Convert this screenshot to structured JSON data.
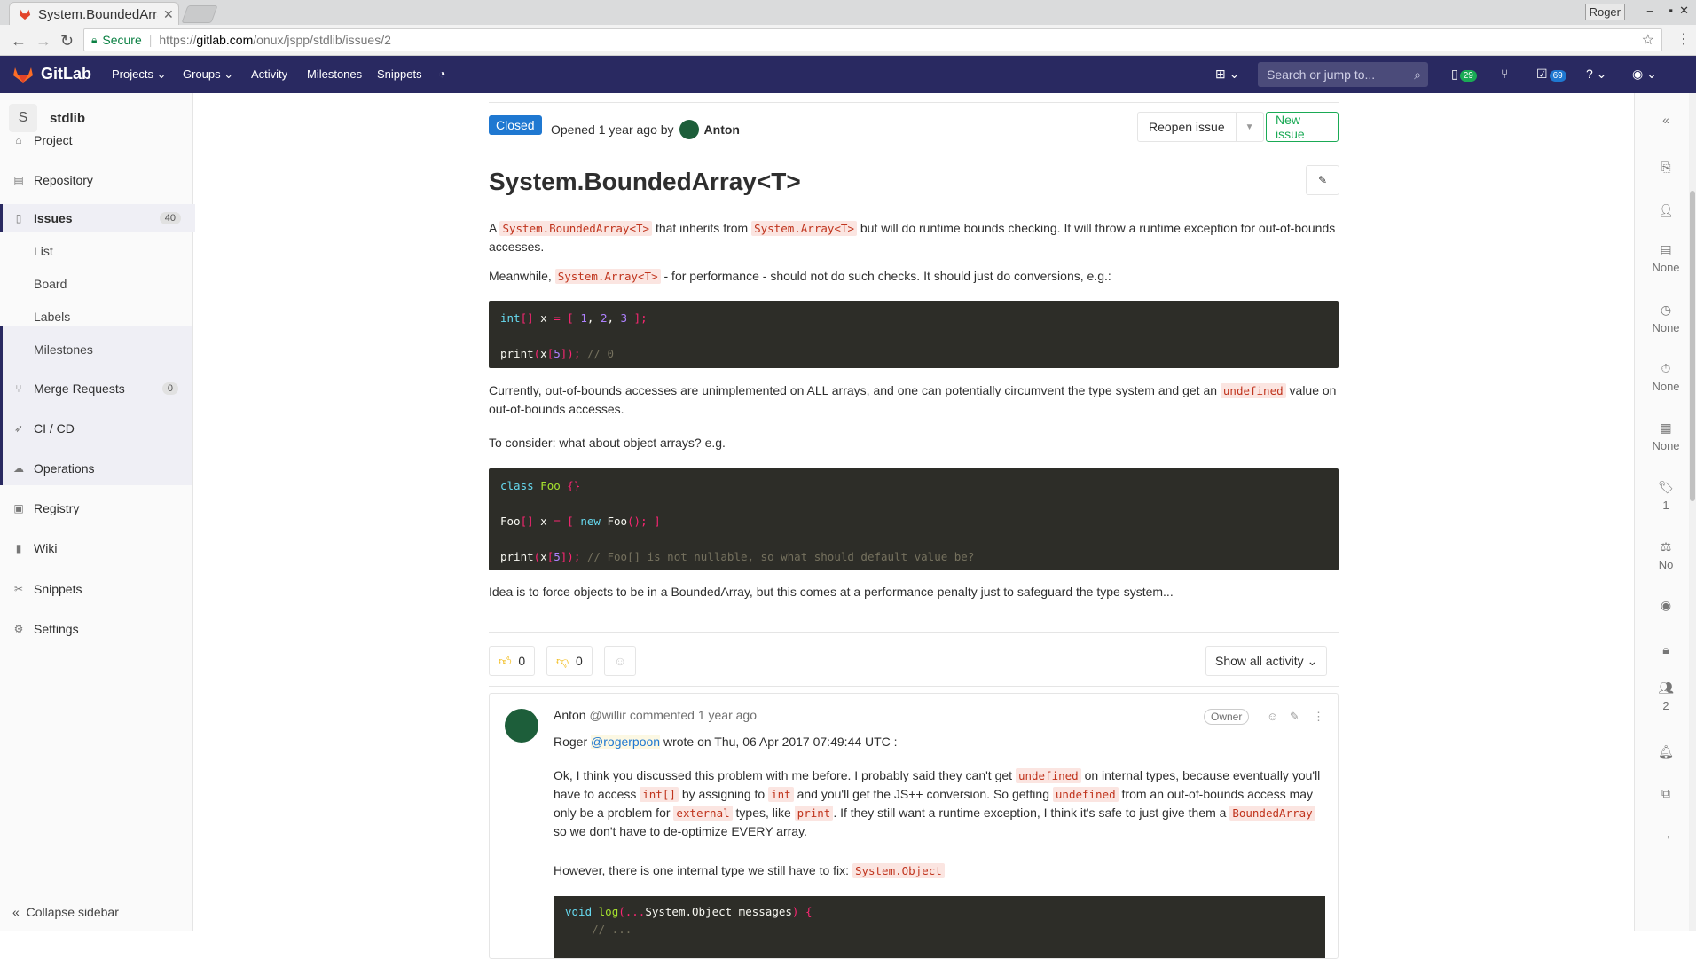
{
  "browser": {
    "tab_title": "System.BoundedArray",
    "tab_close": "✕",
    "user_badge": "Roger",
    "secure_label": "Secure",
    "url_scheme": "https://",
    "url_host": "gitlab.com",
    "url_path": "/onux/jspp/stdlib/issues/2"
  },
  "header": {
    "brand": "GitLab",
    "nav": [
      "Projects",
      "Groups",
      "Activity",
      "Milestones",
      "Snippets"
    ],
    "search_placeholder": "Search or jump to...",
    "issues_count": "29",
    "todos_count": "69",
    "accent": "#292961"
  },
  "sidebar": {
    "project_initial": "S",
    "project_name": "stdlib",
    "items": [
      {
        "label": "Project"
      },
      {
        "label": "Repository"
      },
      {
        "label": "Issues",
        "count": "40"
      },
      {
        "label": "Merge Requests",
        "count": "0"
      },
      {
        "label": "CI / CD"
      },
      {
        "label": "Operations"
      },
      {
        "label": "Registry"
      },
      {
        "label": "Wiki"
      },
      {
        "label": "Snippets"
      },
      {
        "label": "Settings"
      }
    ],
    "sub_items": [
      "List",
      "Board",
      "Labels",
      "Milestones"
    ],
    "collapse_label": "Collapse sidebar"
  },
  "right_sidebar": {
    "milestone": "None",
    "time_tracking": "None",
    "due_date": "None",
    "labels": "None",
    "labels_count": "1",
    "confidential": "No",
    "participants": "2"
  },
  "issue": {
    "status": "Closed",
    "opened_text": "Opened 1 year ago by",
    "author": "Anton",
    "reopen_label": "Reopen issue",
    "new_issue_label": "New issue",
    "title": "System.BoundedArray<T>",
    "p1_a": "A",
    "p1_code1": "System.BoundedArray<T>",
    "p1_b": "that inherits from",
    "p1_code2": "System.Array<T>",
    "p1_c": "but will do runtime bounds checking. It will throw a runtime exception for out-of-bounds accesses.",
    "p2_a": "Meanwhile,",
    "p2_code": "System.Array<T>",
    "p2_b": "- for performance - should not do such checks. It should just do conversions, e.g.:",
    "p3_a": "Currently, out-of-bounds accesses are unimplemented on ALL arrays, and one can potentially circumvent the type system and get an",
    "p3_code": "undefined",
    "p3_b": "value on out-of-bounds accesses.",
    "p4": "To consider: what about object arrays? e.g.",
    "p5": "Idea is to force objects to be in a BoundedArray, but this comes at a performance penalty just to safeguard the type system...",
    "thumbs_up": "0",
    "thumbs_down": "0",
    "show_activity": "Show all activity"
  },
  "comment": {
    "author": "Anton",
    "handle": "@willir",
    "meta": "commented 1 year ago",
    "role": "Owner",
    "quote_author": "Roger",
    "quote_handle": "@rogerpoon",
    "quote_date": "wrote on Thu, 06 Apr 2017 07:49:44 UTC :",
    "q1_a": "Ok, I think you discussed this problem with me before. I probably said they can't get",
    "q1_c1": "undefined",
    "q1_b": "on internal types, because eventually you'll have to access",
    "q1_c2": "int[]",
    "q1_c": "by assigning to",
    "q1_c3": "int",
    "q1_d": "and you'll get the JS++ conversion. So getting",
    "q1_c4": "undefined",
    "q1_e": "from an out-of-bounds access may only be a problem for",
    "q1_c5": "external",
    "q1_f": "types, like",
    "q1_c6": "print",
    "q1_g": ". If they still want a runtime exception, I think it's safe to just give them a",
    "q1_c7": "BoundedArray",
    "q1_h": "so we don't have to de-optimize EVERY array.",
    "q2_a": "However, there is one internal type we still have to fix:",
    "q2_code": "System.Object"
  }
}
